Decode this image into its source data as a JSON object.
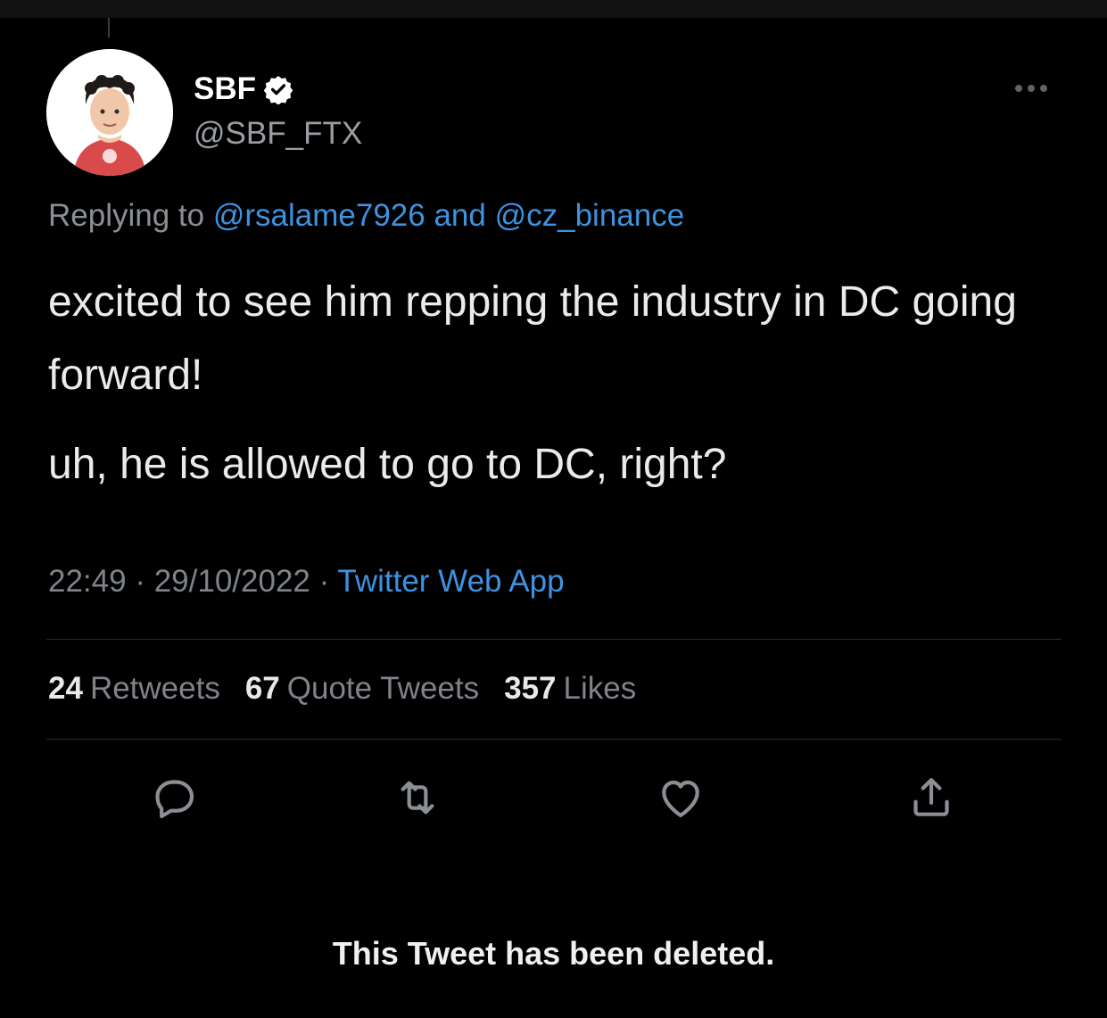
{
  "tweet": {
    "display_name": "SBF",
    "handle": "@SBF_FTX",
    "reply": {
      "prefix": "Replying to",
      "mention_1": "@rsalame7926",
      "connector": "and",
      "mention_2": "@cz_binance"
    },
    "body": {
      "paragraph_1": "excited to see him repping the industry in DC going forward!",
      "paragraph_2": "uh, he is allowed to go to DC, right?"
    },
    "meta": {
      "time": "22:49",
      "separator": "·",
      "date": "29/10/2022",
      "source": "Twitter Web App"
    },
    "stats": {
      "retweets_count": "24",
      "retweets_label": "Retweets",
      "quotes_count": "67",
      "quotes_label": "Quote Tweets",
      "likes_count": "357",
      "likes_label": "Likes"
    }
  },
  "actions": {
    "icons": [
      "reply-icon",
      "retweet-icon",
      "like-icon",
      "share-icon"
    ]
  },
  "notice": {
    "text": "This Tweet has been deleted."
  },
  "colors": {
    "background": "#000000",
    "link": "#3e92e0",
    "muted": "#7f838a",
    "text": "#e7e9ea"
  }
}
